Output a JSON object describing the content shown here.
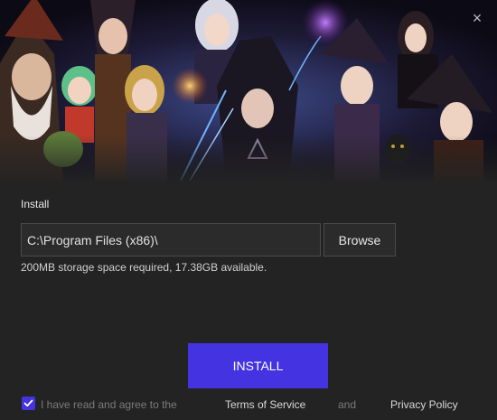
{
  "window": {
    "close_icon": "close-icon",
    "close_glyph": "×"
  },
  "banner": {
    "image": "fantasy-game-characters-artwork"
  },
  "install": {
    "section_label": "Install",
    "path_value": "C:\\Program Files (x86)\\",
    "browse_label": "Browse",
    "storage_info": "200MB storage space required, 17.38GB available.",
    "install_label": "INSTALL"
  },
  "agreement": {
    "checked": true,
    "text": "I have read and agree to the",
    "terms_label": "Terms of Service",
    "and_text": "and",
    "privacy_label": "Privacy Policy"
  },
  "colors": {
    "background": "#232323",
    "accent": "#4433e0",
    "input_border": "#4a4a4a"
  }
}
